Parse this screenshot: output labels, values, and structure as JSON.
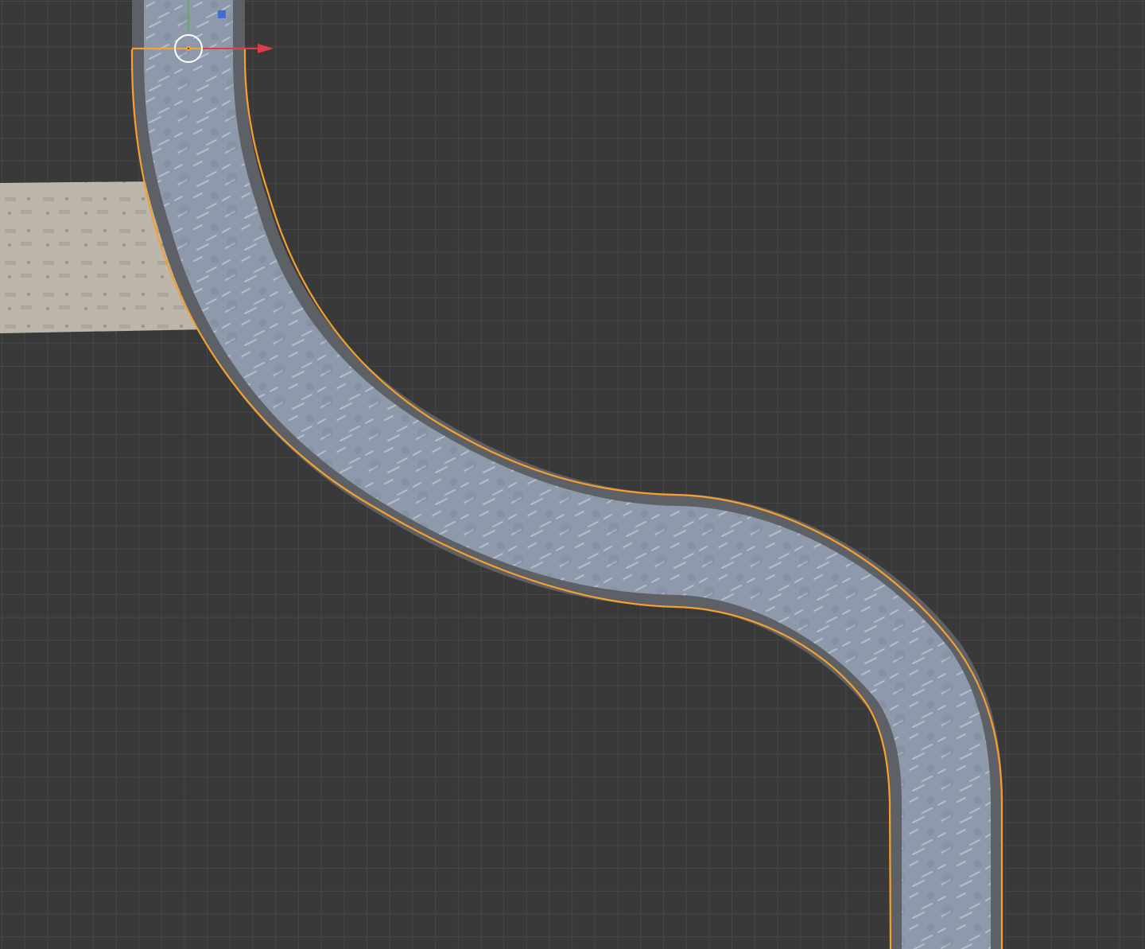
{
  "app": {
    "editor": "3D Viewport",
    "view": "Top Orthographic"
  },
  "colors": {
    "background": "#393939",
    "grid_line": "#474747",
    "selection_outline": "#f5a030",
    "river_water": "#8e9aab",
    "river_bank": "#5d6064",
    "stone_path": "#bdb6ab",
    "axis_x": "#e03a4e",
    "axis_y": "#59b544",
    "axis_z": "#3f6fcf"
  },
  "scene": {
    "objects": [
      {
        "name": "river-curve",
        "selected": true,
        "material": "water"
      },
      {
        "name": "stone-path",
        "selected": false,
        "material": "stone"
      }
    ],
    "gizmo": {
      "mode": "move",
      "axes": [
        "x-axis-arrow",
        "y-axis-line",
        "z-axis-handle"
      ],
      "icons": [
        "3d-cursor-icon"
      ]
    }
  }
}
